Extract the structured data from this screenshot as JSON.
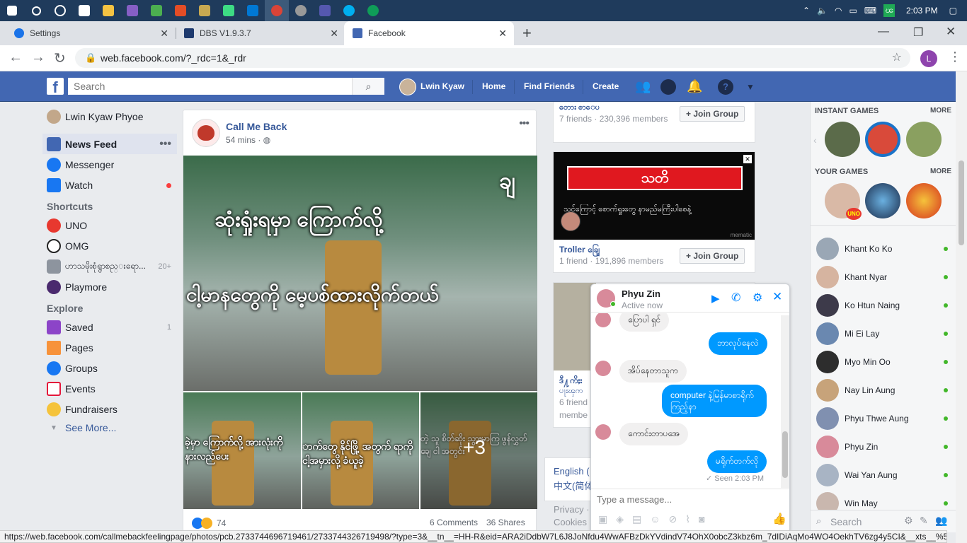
{
  "taskbar": {
    "time": "2:03 PM"
  },
  "tabs": [
    {
      "label": "Settings"
    },
    {
      "label": "DBS V1.9.3.7"
    },
    {
      "label": "Facebook"
    }
  ],
  "address": {
    "url": "web.facebook.com/?_rdc=1&_rdr"
  },
  "fb": {
    "search_placeholder": "Search",
    "user": "Lwin Kyaw",
    "nav": [
      "Home",
      "Find Friends",
      "Create"
    ]
  },
  "left_nav": {
    "profile": "Lwin Kyaw Phyoe",
    "main": [
      {
        "label": "News Feed"
      },
      {
        "label": "Messenger"
      },
      {
        "label": "Watch"
      }
    ],
    "shortcuts_title": "Shortcuts",
    "shortcuts": [
      {
        "label": "UNO",
        "count": ""
      },
      {
        "label": "OMG",
        "count": ""
      },
      {
        "label": "ဟာသမိုးစုံရွာစည္းရော...",
        "count": "20+"
      },
      {
        "label": "Playmore",
        "count": ""
      }
    ],
    "explore_title": "Explore",
    "explore": [
      {
        "label": "Saved",
        "count": "1"
      },
      {
        "label": "Pages",
        "count": ""
      },
      {
        "label": "Groups",
        "count": ""
      },
      {
        "label": "Events",
        "count": ""
      },
      {
        "label": "Fundraisers",
        "count": ""
      }
    ],
    "see_more": "See More..."
  },
  "post": {
    "page_name": "Call Me Back",
    "time": "54 mins",
    "image_text_1": "ဆုံးရှုံးရမှာ ကြောက်လို့",
    "image_text_2": "ငါ့မာနတွေကို မေ့ပစ်ထားလိုက်တယ်",
    "image_corner": "ချ",
    "thumb_1": "ခဲ့မှာ ကြောက်လို့ အားလုံးကို နားလည်ပေး",
    "thumb_2": "ာက်တွေ နိုင်ဖြို့ အတွက် ရာကို ငါ့အမှားလို့ ခံယူခဲ့",
    "thumb_3": "တဲ့ သူ စိတ်ဆိုး သွားမှာကြ ဖွန်လွှတ်ချေ ငါ အတွင်း",
    "more_count": "+3",
    "reactions": "74",
    "comments": "6 Comments",
    "shares": "36 Shares"
  },
  "groups": [
    {
      "name": "တေား စာေပ",
      "meta": "7 friends · 230,396 members",
      "join": "Join Group"
    },
    {
      "name": "Troller ချြေ",
      "meta": "1 friend · 191,896 members",
      "join": "Join Group",
      "ad_title": "သတိ",
      "ad_text": "သင်ကြောင့် စောက်ရှုးတွေ နာမည်မကြီးပါစေနဲ့",
      "ad_brand": "mematic"
    },
    {
      "name": "ဒီ႔ကိႈး",
      "meta2": "ပႃးၾက",
      "meta": "6 friend",
      "meta3": "membe"
    }
  ],
  "lang": {
    "l1": "English (",
    "l2": "中文(简体"
  },
  "footer": {
    "privacy": "Privacy ·",
    "cookies": "Cookies"
  },
  "instant_games": {
    "title": "INSTANT GAMES",
    "more": "MORE"
  },
  "your_games": {
    "title": "YOUR GAMES",
    "more": "MORE",
    "uno_badge": "UNO"
  },
  "contacts": [
    {
      "name": "Khant Ko Ko"
    },
    {
      "name": "Khant Nyar"
    },
    {
      "name": "Ko Htun Naing"
    },
    {
      "name": "Mi Ei Lay"
    },
    {
      "name": "Myo Min Oo"
    },
    {
      "name": "Nay Lin Aung"
    },
    {
      "name": "Phyu Thwe Aung"
    },
    {
      "name": "Phyu Zin"
    },
    {
      "name": "Wai Yan Aung"
    },
    {
      "name": "Win May"
    }
  ],
  "chat_search": "Search",
  "chat": {
    "name": "Phyu Zin",
    "status": "Active now",
    "messages": [
      {
        "dir": "in",
        "text": "ပြောပါ ရှင်"
      },
      {
        "dir": "out",
        "text": "ဘာလုပ်နေလဲ"
      },
      {
        "dir": "in",
        "text": "အိပ်နေတာသူက"
      },
      {
        "dir": "out",
        "text": "computer နဲ့မြန်မာစာရိုက် ကြည့်နာ"
      },
      {
        "dir": "in",
        "text": "ကောင်းတာပအေ"
      },
      {
        "dir": "out",
        "text": "မရိုက်တက်လို"
      }
    ],
    "seen": "Seen 2:03 PM",
    "input_placeholder": "Type a message..."
  },
  "status_url": "https://web.facebook.com/callmebackfeelingpage/photos/pcb.2733744696719461/2733744326719498/?type=3&__tn__=HH-R&eid=ARA2iDdbW7L6J8JoNfdu4WwAFBzDkYVdindV74OhX0obcZ3kbz6m_7dIDiAqMo4WO4OekhTV6zg4y5CI&__xts__%5B..."
}
